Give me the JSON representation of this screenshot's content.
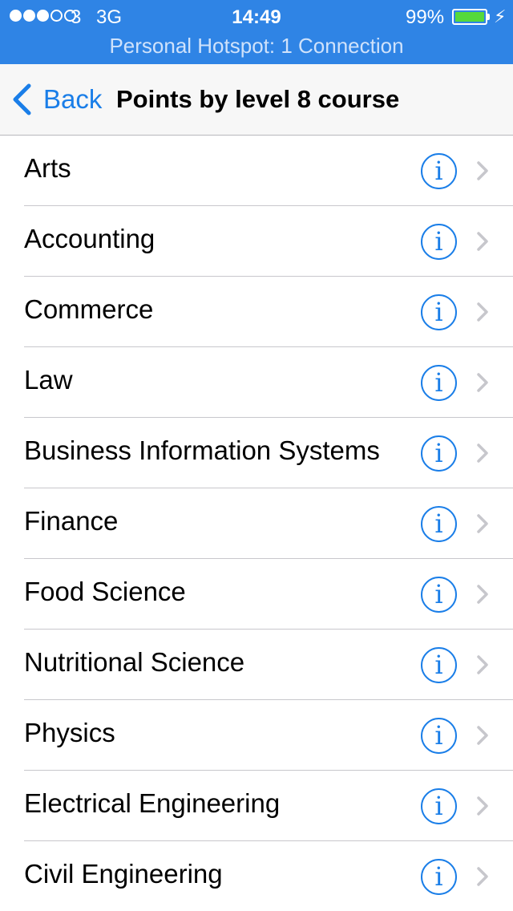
{
  "status_bar": {
    "carrier": "3",
    "network": "3G",
    "time": "14:49",
    "battery": "99%",
    "hotspot": "Personal Hotspot: 1 Connection",
    "colors": {
      "background": "#2f84e5",
      "battery_fill": "#55d93c"
    }
  },
  "nav": {
    "back_label": "Back",
    "title": "Points by level 8 course"
  },
  "courses": [
    "Arts",
    "Accounting",
    "Commerce",
    "Law",
    "Business Information Systems",
    "Finance",
    "Food Science",
    "Nutritional Science",
    "Physics",
    "Electrical Engineering",
    "Civil Engineering"
  ],
  "info_symbol": "i",
  "colors": {
    "accent": "#1a7ee8",
    "separator": "#c8c7cc",
    "chevron": "#c7c7cc"
  }
}
